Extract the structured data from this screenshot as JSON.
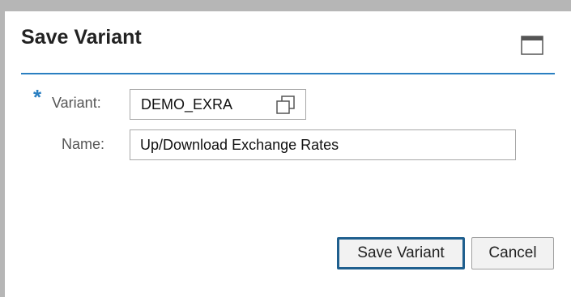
{
  "dialog": {
    "title": "Save Variant"
  },
  "form": {
    "required_marker": "*",
    "variant": {
      "label": "Variant:",
      "value": "DEMO_EXRA",
      "icon": "value-help-icon"
    },
    "name": {
      "label": "Name:",
      "value": "Up/Download Exchange Rates"
    }
  },
  "buttons": {
    "save": "Save Variant",
    "cancel": "Cancel"
  },
  "colors": {
    "accent": "#2a7fc1",
    "frame": "#b6b6b6",
    "focus_border": "#1f5f8e"
  }
}
